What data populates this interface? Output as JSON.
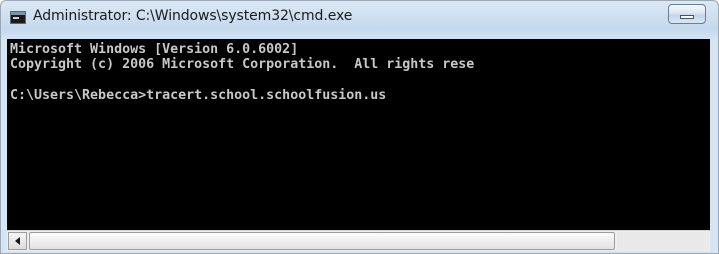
{
  "window": {
    "title": "Administrator: C:\\Windows\\system32\\cmd.exe",
    "icon": "cmd-window-icon",
    "minimize_icon": "minimize-icon"
  },
  "console": {
    "lines": [
      "Microsoft Windows [Version 6.0.6002]",
      "Copyright (c) 2006 Microsoft Corporation.  All rights rese",
      "",
      "C:\\Users\\Rebecca>tracert.school.schoolfusion.us"
    ]
  },
  "scrollbar": {
    "left_arrow_icon": "scroll-left-arrow-icon"
  }
}
